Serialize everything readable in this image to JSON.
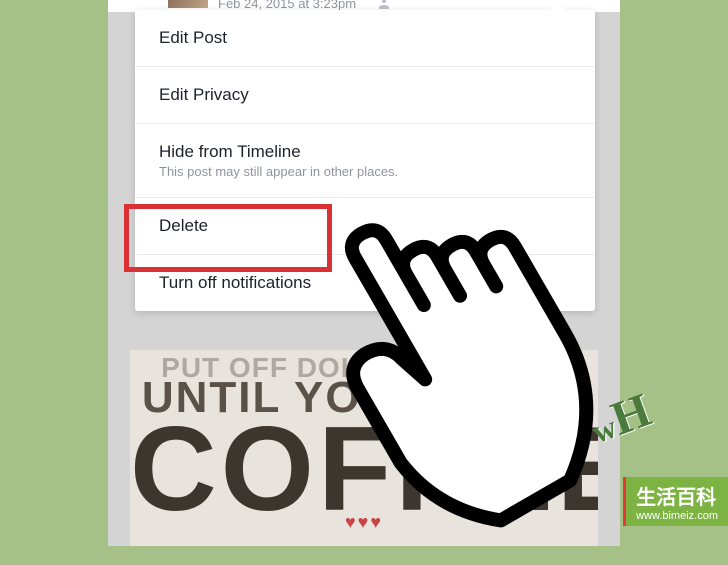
{
  "post": {
    "timestamp": "Feb 24, 2015 at 3:23pm",
    "audience_icon": "friends"
  },
  "menu": {
    "items": [
      {
        "title": "Edit Post",
        "subtitle": ""
      },
      {
        "title": "Edit Privacy",
        "subtitle": ""
      },
      {
        "title": "Hide from Timeline",
        "subtitle": "This post may still appear in other places."
      },
      {
        "title": "Delete",
        "subtitle": ""
      },
      {
        "title": "Turn off notifications",
        "subtitle": ""
      }
    ]
  },
  "poster": {
    "line1": "PUT OFF DOING ONE THING",
    "line2": "UNTIL YOU'VE HAD",
    "main": "COFFEE",
    "hearts": "♥♥♥"
  },
  "logo": {
    "w": "w",
    "h": "H"
  },
  "badge": {
    "title": "生活百科",
    "url": "www.bimeiz.com"
  }
}
